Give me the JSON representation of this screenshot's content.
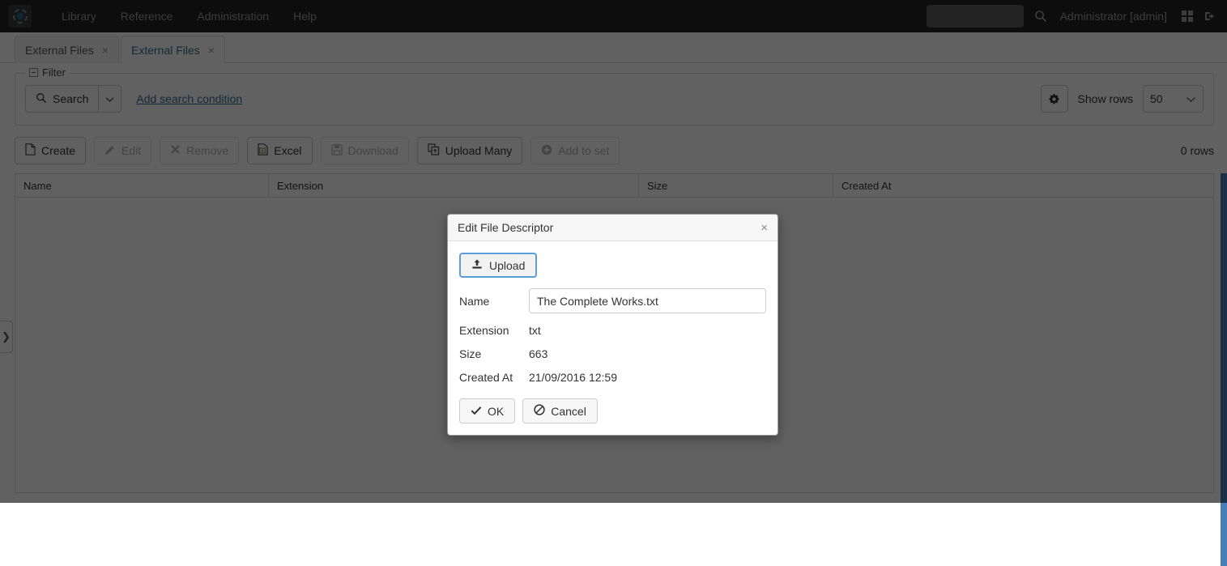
{
  "navbar": {
    "logo_icon": "app-logo-icon",
    "links": [
      {
        "label": "Library"
      },
      {
        "label": "Reference"
      },
      {
        "label": "Administration"
      },
      {
        "label": "Help"
      }
    ],
    "search": {
      "value": "",
      "placeholder": ""
    },
    "search_icon": "search-icon",
    "user": "Administrator [admin]",
    "apps_icon": "grid-apps-icon",
    "logout_icon": "logout-icon"
  },
  "tabs": [
    {
      "label": "External Files",
      "close": "×",
      "active": false
    },
    {
      "label": "External Files",
      "close": "×",
      "active": true
    }
  ],
  "left_handle": {
    "glyph": "❯"
  },
  "filter": {
    "legend": "Filter",
    "search_label": "Search",
    "search_icon": "magnifier-icon",
    "caret_icon": "chevron-down-icon",
    "add_condition": "Add search condition",
    "gear_icon": "gear-icon",
    "show_rows_label": "Show rows",
    "show_rows_value": "50",
    "show_rows_options": [
      "50"
    ]
  },
  "toolbar": {
    "buttons": [
      {
        "label": "Create",
        "icon": "file-icon",
        "enabled": true
      },
      {
        "label": "Edit",
        "icon": "pencil-icon",
        "enabled": false
      },
      {
        "label": "Remove",
        "icon": "cross-icon",
        "enabled": false
      },
      {
        "label": "Excel",
        "icon": "excel-icon",
        "enabled": true
      },
      {
        "label": "Download",
        "icon": "save-disk-icon",
        "enabled": false
      },
      {
        "label": "Upload Many",
        "icon": "copy-upload-icon",
        "enabled": true
      },
      {
        "label": "Add to set",
        "icon": "plus-circle-icon",
        "enabled": false
      }
    ],
    "rows_count": "0 rows"
  },
  "grid": {
    "columns": [
      "Name",
      "Extension",
      "Size",
      "Created At"
    ],
    "rows": []
  },
  "modal": {
    "title": "Edit File Descriptor",
    "close_glyph": "×",
    "upload_label": "Upload",
    "upload_icon": "upload-icon",
    "fields": {
      "name_label": "Name",
      "name_value": "The Complete Works.txt",
      "name_placeholder": "",
      "extension_label": "Extension",
      "extension_value": "txt",
      "size_label": "Size",
      "size_value": "663",
      "created_at_label": "Created At",
      "created_at_value": "21/09/2016 12:59"
    },
    "ok_label": "OK",
    "ok_icon": "check-icon",
    "cancel_label": "Cancel",
    "cancel_icon": "ban-icon"
  },
  "colors": {
    "navbar_bg": "#222222",
    "accent_link": "#31708f",
    "focus_border": "#5b9dd9",
    "scrollbar": "#4a7ebb"
  }
}
